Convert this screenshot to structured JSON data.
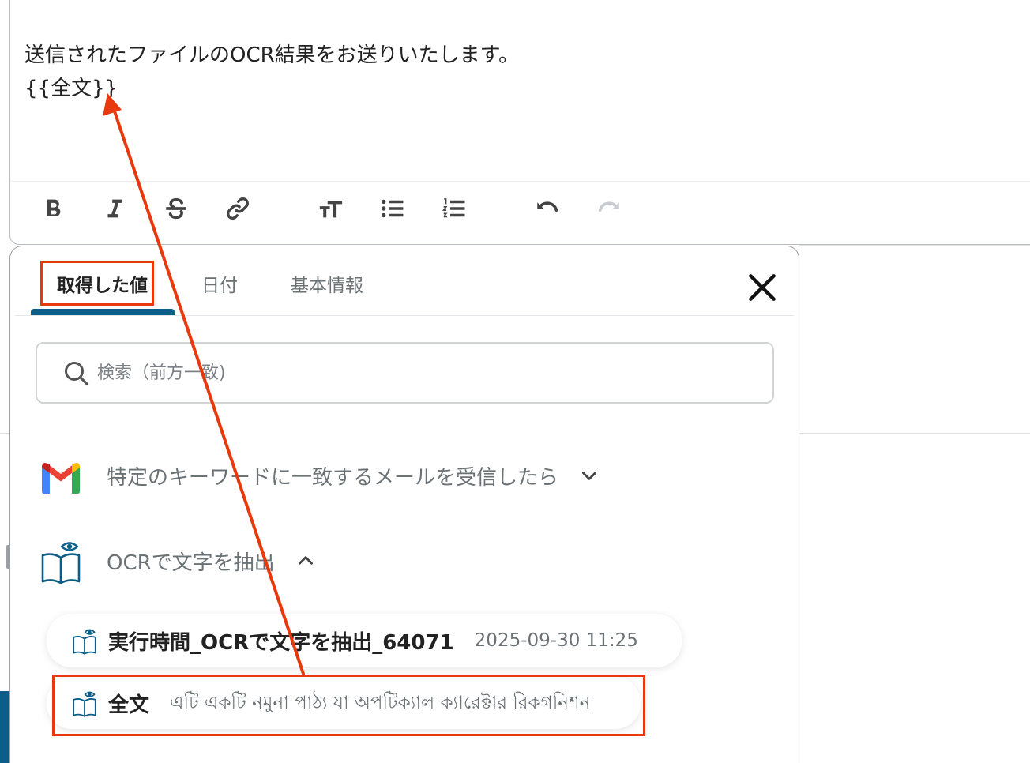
{
  "editor": {
    "body_line1": "送信されたファイルのOCR結果をお送りいたします。",
    "body_line2": "{{全文}}",
    "toolbar": [
      "bold-icon",
      "italic-icon",
      "strikethrough-icon",
      "link-icon",
      "text-size-icon",
      "bulleted-list-icon",
      "numbered-list-icon",
      "undo-icon",
      "redo-icon"
    ]
  },
  "panel": {
    "tabs": [
      {
        "label": "取得した値",
        "active": true
      },
      {
        "label": "日付",
        "active": false
      },
      {
        "label": "基本情報",
        "active": false
      }
    ],
    "close_icon": "close-icon",
    "search": {
      "placeholder": "検索（前方一致)",
      "value": ""
    },
    "groups": [
      {
        "label": "特定のキーワードに一致するメールを受信したら",
        "icon": "gmail-icon",
        "expanded": false
      },
      {
        "label": "OCRで文字を抽出",
        "icon": "ocr-book-icon",
        "expanded": true
      }
    ],
    "items": [
      {
        "title": "実行時間_OCRで文字を抽出_64071",
        "value": "2025-09-30 11:25"
      },
      {
        "title": "全文",
        "value": "এটি একটি নমুনা পাঠ্য যা অপটিক্যাল ক্যারেক্টার রিকগনিশন"
      }
    ]
  },
  "colors": {
    "accent": "#0b5e88",
    "annotation": "#e8380d",
    "muted_text": "#6b7276"
  }
}
